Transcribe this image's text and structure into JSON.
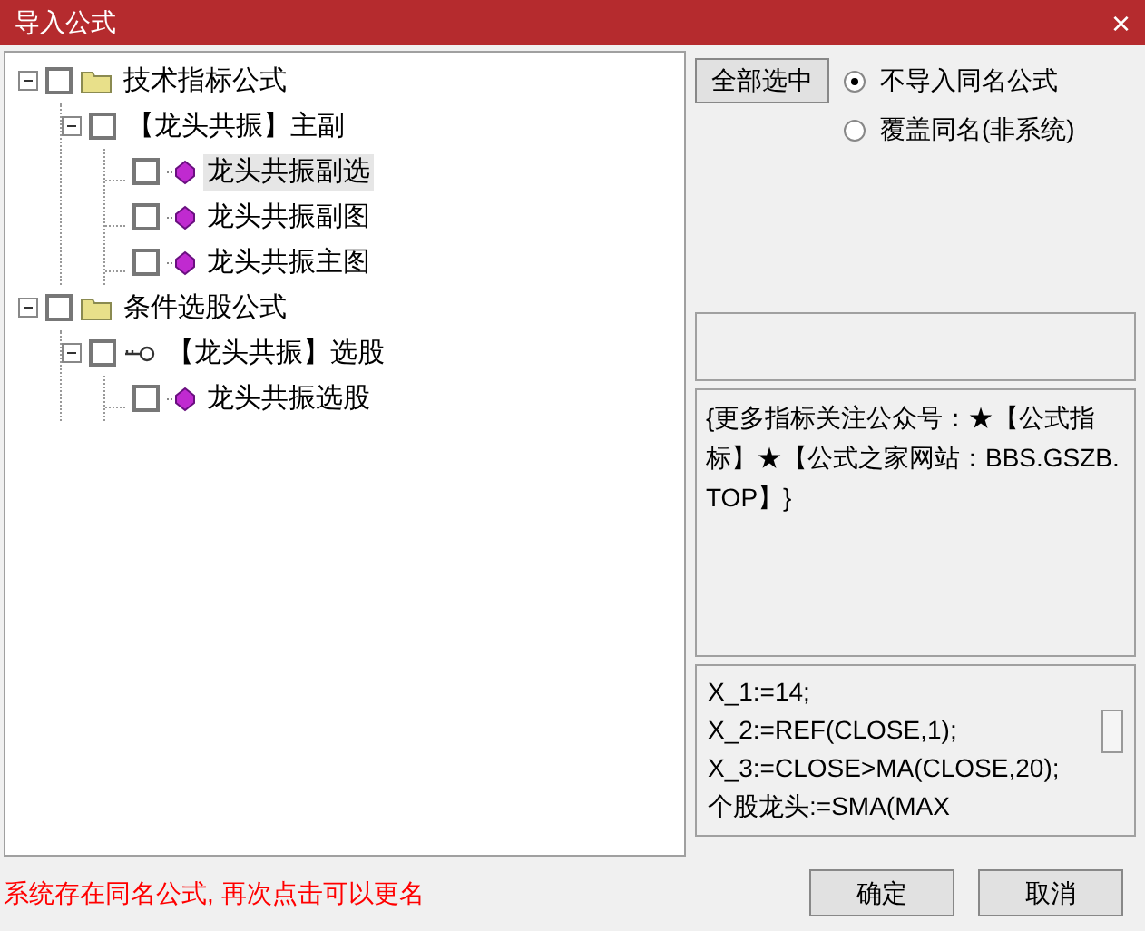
{
  "window": {
    "title": "导入公式",
    "close": "×"
  },
  "tree": [
    {
      "kind": "folder",
      "label": "技术指标公式",
      "checked": false,
      "expanded": true,
      "selected": false,
      "children": [
        {
          "kind": "group",
          "label": "【龙头共振】主副",
          "checked": false,
          "expanded": true,
          "selected": false,
          "children": [
            {
              "kind": "formula",
              "label": "龙头共振副选",
              "checked": false,
              "selected": true
            },
            {
              "kind": "formula",
              "label": "龙头共振副图",
              "checked": false,
              "selected": false
            },
            {
              "kind": "formula",
              "label": "龙头共振主图",
              "checked": false,
              "selected": false
            }
          ]
        }
      ]
    },
    {
      "kind": "folder",
      "label": "条件选股公式",
      "checked": false,
      "expanded": true,
      "selected": false,
      "children": [
        {
          "kind": "key",
          "label": "【龙头共振】选股",
          "checked": false,
          "expanded": true,
          "selected": false,
          "children": [
            {
              "kind": "formula",
              "label": "龙头共振选股",
              "checked": false,
              "selected": false
            }
          ]
        }
      ]
    }
  ],
  "select_all_button": "全部选中",
  "options": [
    {
      "label": "不导入同名公式",
      "selected": true
    },
    {
      "label": "覆盖同名(非系统)",
      "selected": false
    }
  ],
  "description": "{更多指标关注公众号：★【公式指标】★【公式之家网站：BBS.GSZB.TOP】}",
  "code_lines": [
    "X_1:=14;",
    "X_2:=REF(CLOSE,1);",
    "X_3:=CLOSE>MA(CLOSE,20);",
    "个股龙头:=SMA(MAX"
  ],
  "status_message": "系统存在同名公式, 再次点击可以更名",
  "buttons": [
    "确定",
    "取消"
  ]
}
